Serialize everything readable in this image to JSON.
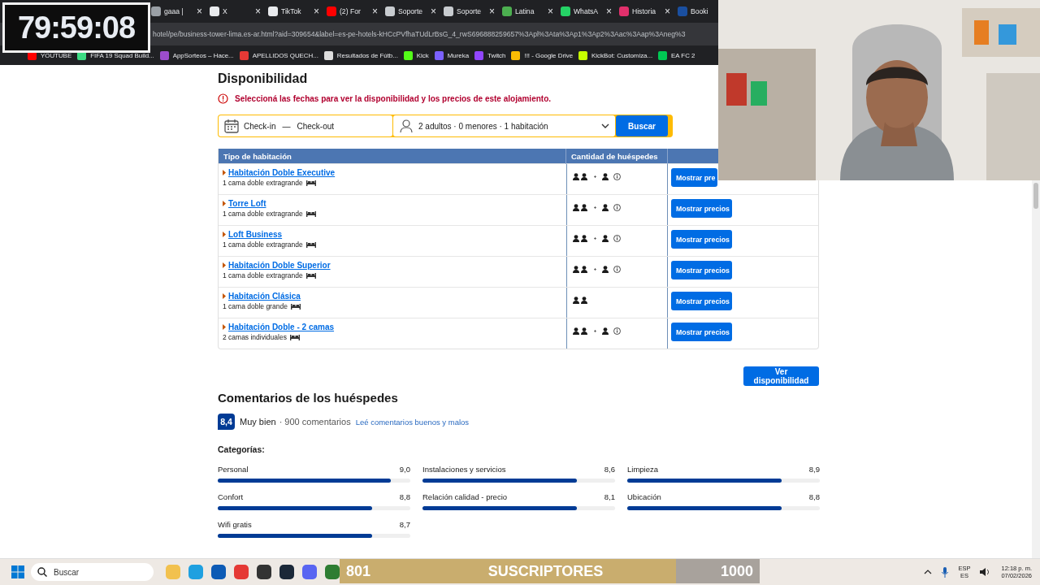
{
  "browser": {
    "tabs": [
      {
        "label": "gaaa |",
        "color": "#9aa0a6",
        "close": "×"
      },
      {
        "label": "X",
        "color": "#e8eaed",
        "close": "×"
      },
      {
        "label": "TikTok",
        "color": "#e8eaed",
        "close": "×"
      },
      {
        "label": "(2) For",
        "color": "#ff0000",
        "close": "×"
      },
      {
        "label": "Soporte",
        "color": "#c8ccd0",
        "close": "×"
      },
      {
        "label": "Soporte",
        "color": "#c8ccd0",
        "close": "×"
      },
      {
        "label": "Latina",
        "color": "#4caf50",
        "close": "×"
      },
      {
        "label": "WhatsA",
        "color": "#25d366",
        "close": "×"
      },
      {
        "label": "Historia",
        "color": "#e1306c",
        "close": "×"
      },
      {
        "label": "Booki",
        "color": "#1a4fa0"
      }
    ],
    "address": "hotel/pe/business-tower-lima.es-ar.html?aid=309654&label=es-pe-hotels-kHCcPVfhaTUdLrBsG_4_rwS696888259657%3Apl%3Ata%3Ap1%3Ap2%3Aac%3Aap%3Aneg%3",
    "bookmarks": [
      {
        "label": "YOUTUBE",
        "color": "#ff0000"
      },
      {
        "label": "FIFA 19 Squad Build...",
        "color": "#3ddc84"
      },
      {
        "label": "AppSorteos – Hace...",
        "color": "#9c4dcc"
      },
      {
        "label": "APELLIDOS QUECH...",
        "color": "#e53935"
      },
      {
        "label": "Resultados de Fútb...",
        "color": "#dddddd"
      },
      {
        "label": "Kick",
        "color": "#53fc18"
      },
      {
        "label": "Mureka",
        "color": "#7b61ff"
      },
      {
        "label": "Twitch",
        "color": "#9146ff"
      },
      {
        "label": "!!! - Google Drive",
        "color": "#fbbc04"
      },
      {
        "label": "KickBot: Customiza...",
        "color": "#c6ff00"
      },
      {
        "label": "EA FC 2",
        "color": "#00c853"
      }
    ]
  },
  "timer": "79:59:08",
  "availability": {
    "title": "Disponibilidad",
    "alert": "Seleccioná las fechas para ver la disponibilidad y los precios de este alojamiento.",
    "checkin": "Check-in",
    "separator": "—",
    "checkout": "Check-out",
    "guests": "2 adultos · 0 menores · 1 habitación",
    "search_button": "Buscar",
    "columns": [
      "Tipo de habitación",
      "Cantidad de huéspedes"
    ],
    "rooms": [
      {
        "name": "Habitación Doble Executive",
        "beds": "1 cama doble extragrande",
        "extra_guest": true,
        "button": "Mostrar pre"
      },
      {
        "name": "Torre Loft",
        "beds": "1 cama doble extragrande",
        "extra_guest": true,
        "button": "Mostrar precios"
      },
      {
        "name": "Loft Business",
        "beds": "1 cama doble extragrande",
        "extra_guest": true,
        "button": "Mostrar precios"
      },
      {
        "name": "Habitación Doble Superior",
        "beds": "1 cama doble extragrande",
        "extra_guest": true,
        "button": "Mostrar precios"
      },
      {
        "name": "Habitación Clásica",
        "beds": "1 cama doble grande",
        "extra_guest": false,
        "button": "Mostrar precios"
      },
      {
        "name": "Habitación Doble - 2 camas",
        "beds": "2 camas individuales",
        "extra_guest": true,
        "button": "Mostrar precios"
      }
    ],
    "cta": "Ver disponibilidad"
  },
  "reviews": {
    "title": "Comentarios de los huéspedes",
    "score": "8,4",
    "rating": "Muy bien",
    "count": "· 900 comentarios",
    "link": "Leé comentarios buenos y malos",
    "categories_title": "Categorías:",
    "categories": [
      {
        "name": "Personal",
        "score": "9,0",
        "level": 0.9
      },
      {
        "name": "Instalaciones y servicios",
        "score": "8,6",
        "level": 0.8
      },
      {
        "name": "Limpieza",
        "score": "8,9",
        "level": 0.8
      },
      {
        "name": "Confort",
        "score": "8,8",
        "level": 0.8
      },
      {
        "name": "Relación calidad - precio",
        "score": "8,1",
        "level": 0.8
      },
      {
        "name": "Ubicación",
        "score": "8,8",
        "level": 0.8
      },
      {
        "name": "Wifi gratis",
        "score": "8,7",
        "level": 0.8
      }
    ]
  },
  "taskbar": {
    "search_placeholder": "Buscar",
    "subscribers": {
      "current": "801",
      "label": "SUSCRIPTORES",
      "goal": "1000",
      "level": 0.8
    },
    "language": "ESP",
    "layout": "ES",
    "time": "12:18 p. m.",
    "date": "07/02/2026"
  }
}
